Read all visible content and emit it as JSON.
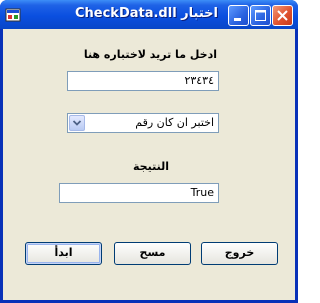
{
  "window": {
    "title": "اختبار CheckData.dll"
  },
  "form": {
    "input_label": "ادخل ما تريد لاختباره هنا",
    "input_value": "٢٣٤٣٤",
    "combo_selected": "اختبر ان كان رقم",
    "result_label": "النتيجة",
    "result_value": "True"
  },
  "buttons": {
    "exit_label": "خروج",
    "clear_label": "مسح",
    "start_label": "ابدأ"
  },
  "icons": {
    "app": "app-icon",
    "minimize": "minimize-icon",
    "maximize": "maximize-icon",
    "close": "close-icon",
    "dropdown": "chevron-down-icon"
  },
  "colors": {
    "titlebar": "#0a4fe0",
    "client": "#ece9d8",
    "close_button": "#e0532f"
  }
}
